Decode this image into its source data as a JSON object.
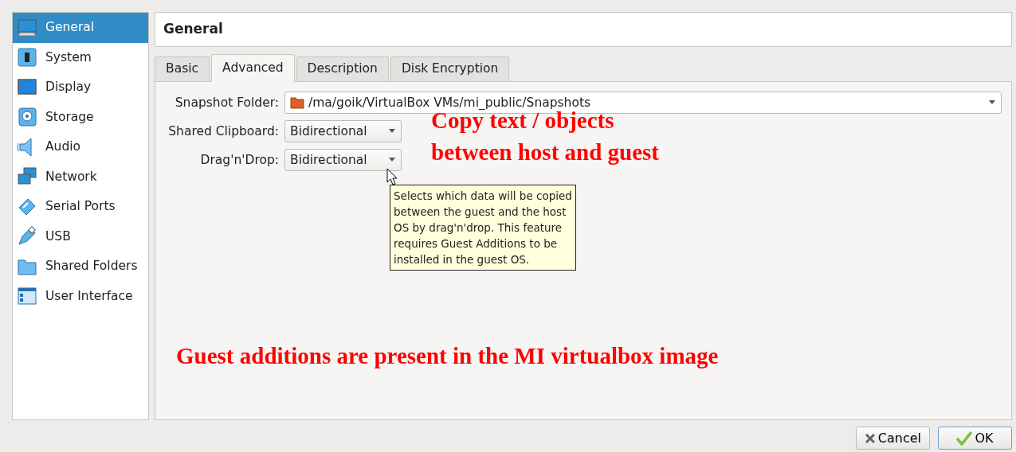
{
  "sidebar": {
    "items": [
      {
        "label": "General",
        "kind": "monitor",
        "selected": true
      },
      {
        "label": "System",
        "kind": "chip",
        "selected": false
      },
      {
        "label": "Display",
        "kind": "display",
        "selected": false
      },
      {
        "label": "Storage",
        "kind": "disk",
        "selected": false
      },
      {
        "label": "Audio",
        "kind": "speaker",
        "selected": false
      },
      {
        "label": "Network",
        "kind": "network",
        "selected": false
      },
      {
        "label": "Serial Ports",
        "kind": "serial",
        "selected": false
      },
      {
        "label": "USB",
        "kind": "usb",
        "selected": false
      },
      {
        "label": "Shared Folders",
        "kind": "folder",
        "selected": false
      },
      {
        "label": "User Interface",
        "kind": "window",
        "selected": false
      }
    ]
  },
  "page_title": "General",
  "tabs": [
    {
      "label": "Basic",
      "selected": false
    },
    {
      "label": "Advanced",
      "selected": true
    },
    {
      "label": "Description",
      "selected": false
    },
    {
      "label": "Disk Encryption",
      "selected": false
    }
  ],
  "fields": [
    {
      "kind": "path",
      "label": "Snapshot Folder:",
      "value": "/ma/goik/VirtualBox VMs/mi_public/Snapshots"
    },
    {
      "kind": "combo",
      "label": "Shared Clipboard:",
      "value": "Bidirectional"
    },
    {
      "kind": "combo",
      "label": "Drag'n'Drop:",
      "value": "Bidirectional"
    }
  ],
  "tooltip": "Selects which data will be copied between the guest and the host OS by drag'n'drop. This feature requires Guest Additions to be installed in the guest OS.",
  "annotations": [
    "Copy text / objects",
    "between host and guest",
    "Guest additions are present in the MI virtualbox image"
  ],
  "buttons": [
    {
      "label": "Cancel",
      "kind": "cancel"
    },
    {
      "label": "OK",
      "kind": "ok"
    }
  ]
}
